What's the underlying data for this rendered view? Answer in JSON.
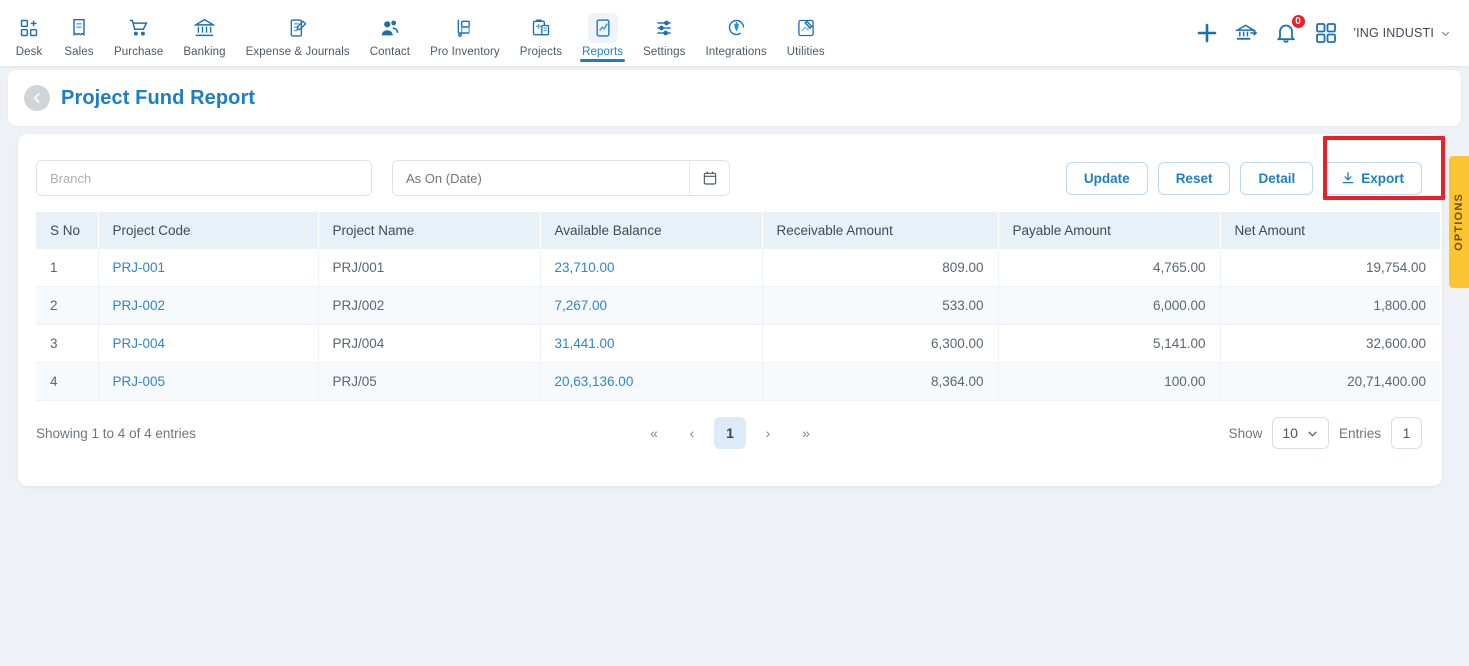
{
  "nav": {
    "items": [
      {
        "label": "Desk",
        "icon": "desk-grid-plus-icon",
        "active": false
      },
      {
        "label": "Sales",
        "icon": "sales-receipt-icon",
        "active": false
      },
      {
        "label": "Purchase",
        "icon": "purchase-cart-icon",
        "active": false
      },
      {
        "label": "Banking",
        "icon": "banking-bank-icon",
        "active": false
      },
      {
        "label": "Expense & Journals",
        "icon": "expense-journal-pen-icon",
        "active": false
      },
      {
        "label": "Contact",
        "icon": "contact-people-icon",
        "active": false
      },
      {
        "label": "Pro Inventory",
        "icon": "pro-inventory-trolley-icon",
        "active": false
      },
      {
        "label": "Projects",
        "icon": "projects-clipboard-icon",
        "active": false
      },
      {
        "label": "Reports",
        "icon": "reports-chart-doc-icon",
        "active": true
      },
      {
        "label": "Settings",
        "icon": "settings-sliders-icon",
        "active": false
      },
      {
        "label": "Integrations",
        "icon": "integrations-plug-icon",
        "active": false
      },
      {
        "label": "Utilities",
        "icon": "utilities-tools-icon",
        "active": false
      }
    ],
    "right": {
      "add_icon": "plus-icon",
      "transfer_icon": "bank-transfer-icon",
      "notification_icon": "bell-icon",
      "notification_count": "0",
      "apps_icon": "grid-apps-icon",
      "company_name": "'ING INDUSTI",
      "company_chevron_icon": "chevron-down-icon"
    }
  },
  "header": {
    "back_icon": "back-chevron-icon",
    "title": "Project Fund Report"
  },
  "filters": {
    "branch": {
      "value": "",
      "placeholder": "Branch"
    },
    "as_on_date": {
      "value": "",
      "placeholder": "As On (Date)",
      "icon": "calendar-icon"
    },
    "buttons": {
      "update": "Update",
      "reset": "Reset",
      "detail": "Detail",
      "export": "Export",
      "export_icon": "download-icon"
    },
    "highlight_color": "#e8202a"
  },
  "options_tab": {
    "label": "OPTIONS",
    "color": "#fdc431"
  },
  "table": {
    "columns": [
      "S No",
      "Project Code",
      "Project Name",
      "Available Balance",
      "Receivable Amount",
      "Payable Amount",
      "Net Amount"
    ],
    "rows": [
      {
        "s_no": "1",
        "project_code": "PRJ-001",
        "project_name": "PRJ/001",
        "available_balance": "23,710.00",
        "receivable_amount": "809.00",
        "payable_amount": "4,765.00",
        "net_amount": "19,754.00"
      },
      {
        "s_no": "2",
        "project_code": "PRJ-002",
        "project_name": "PRJ/002",
        "available_balance": "7,267.00",
        "receivable_amount": "533.00",
        "payable_amount": "6,000.00",
        "net_amount": "1,800.00"
      },
      {
        "s_no": "3",
        "project_code": "PRJ-004",
        "project_name": "PRJ/004",
        "available_balance": "31,441.00",
        "receivable_amount": "6,300.00",
        "payable_amount": "5,141.00",
        "net_amount": "32,600.00"
      },
      {
        "s_no": "4",
        "project_code": "PRJ-005",
        "project_name": "PRJ/05",
        "available_balance": "20,63,136.00",
        "receivable_amount": "8,364.00",
        "payable_amount": "100.00",
        "net_amount": "20,71,400.00"
      }
    ]
  },
  "footer": {
    "showing_text": "Showing 1 to 4 of 4 entries",
    "pagination": {
      "first": "«",
      "prev": "‹",
      "pages": [
        "1"
      ],
      "current_page": "1",
      "next": "›",
      "last": "»"
    },
    "show_label": "Show",
    "page_size": "10",
    "page_size_chevron_icon": "chevron-down-icon",
    "entries_label": "Entries",
    "entry_page_value": "1"
  },
  "colors": {
    "accent": "#1c7fc4",
    "link": "#2f86c8",
    "table_header_bg": "#e9f1f8",
    "highlight": "#e8202a",
    "options_yellow": "#fdc431"
  }
}
